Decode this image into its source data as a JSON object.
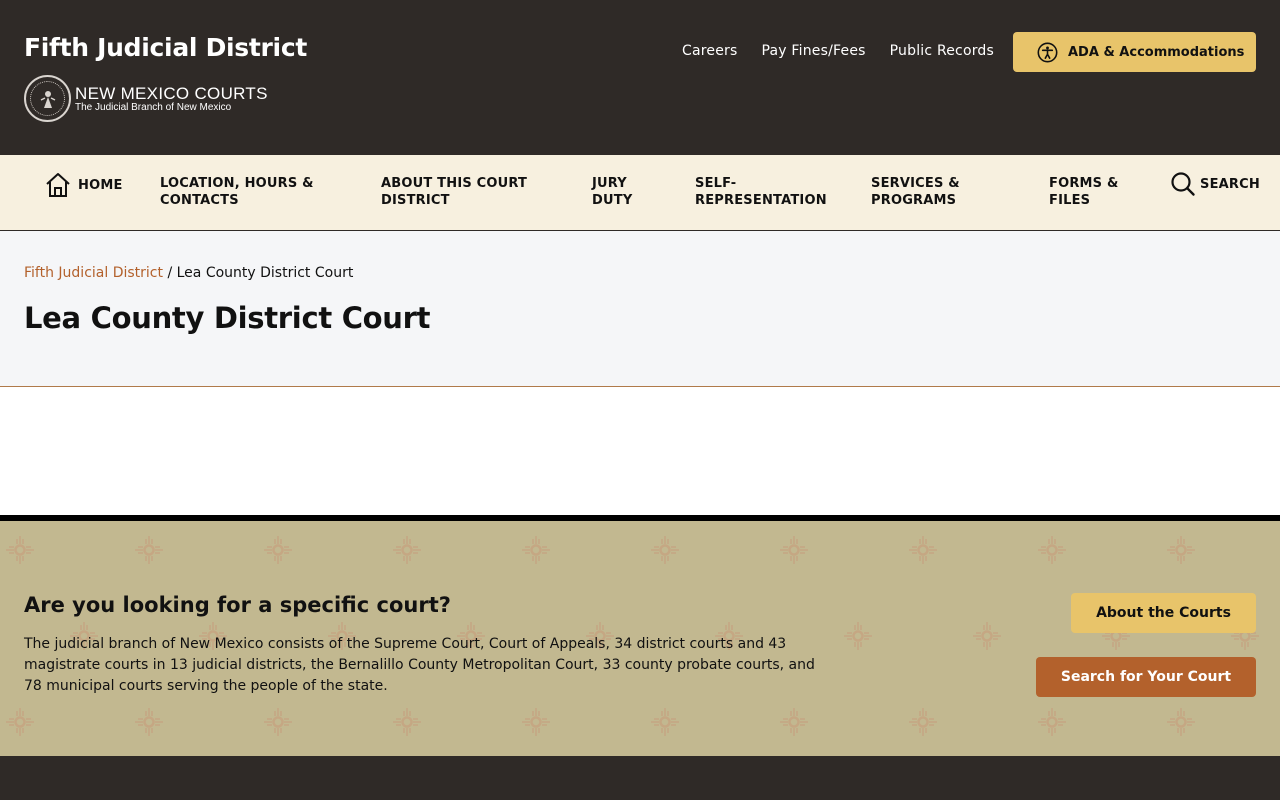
{
  "header": {
    "site_title": "Fifth Judicial District",
    "brand_name": "NEW MEXICO COURTS",
    "brand_sub": "The Judicial Branch of New Mexico",
    "util_links": [
      "Careers",
      "Pay Fines/Fees",
      "Public Records"
    ],
    "ada_label": "ADA & Accommodations"
  },
  "nav": {
    "home": "HOME",
    "items": [
      {
        "line1": "LOCATION, HOURS &",
        "line2": "CONTACTS"
      },
      {
        "line1": "ABOUT THIS COURT",
        "line2": "DISTRICT"
      },
      {
        "line1": "JURY",
        "line2": "DUTY"
      },
      {
        "line1": "SELF-",
        "line2": "REPRESENTATION"
      },
      {
        "line1": "SERVICES &",
        "line2": "PROGRAMS"
      },
      {
        "line1": "FORMS &",
        "line2": "FILES"
      }
    ],
    "search": "SEARCH"
  },
  "breadcrumb": {
    "parent": "Fifth Judicial District",
    "separator": "/",
    "current": "Lea County District Court"
  },
  "page_title": "Lea County District Court",
  "finder": {
    "heading": "Are you looking for a specific court?",
    "body": "The judicial branch of New Mexico consists of the Supreme Court, Court of Appeals, 34 district courts and 43 magistrate courts in 13 judicial districts, the Bernalillo County Metropolitan Court, 33 county probate courts, and 78 municipal courts serving the people of the state.",
    "about_button": "About the Courts",
    "search_button": "Search for Your Court"
  },
  "colors": {
    "header_bg": "#2f2a27",
    "nav_bg": "#f7f0df",
    "accent_gold": "#e8c46a",
    "accent_rust": "#b3612c",
    "finder_bg": "#c2b890"
  },
  "icons": {
    "seal": "new-mexico-seal-icon",
    "ada": "accessibility-icon",
    "home": "home-icon",
    "search": "search-icon",
    "pattern": "zia-sun-icon"
  }
}
